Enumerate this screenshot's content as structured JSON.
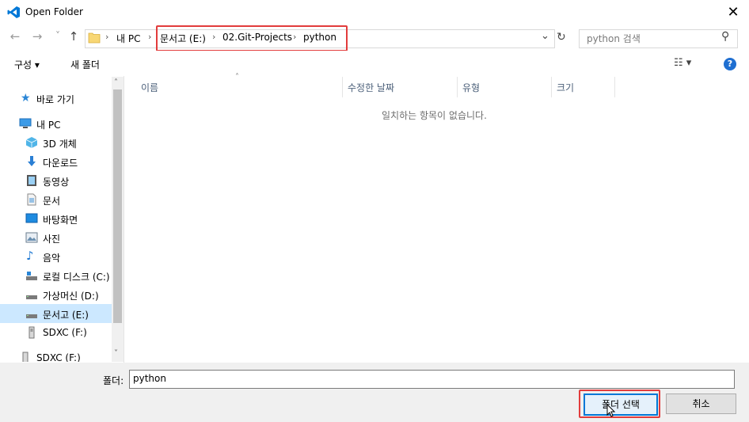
{
  "window": {
    "title": "Open Folder",
    "close_glyph": "✕"
  },
  "nav": {
    "back": "←",
    "forward": "→",
    "recent": "˅",
    "up": "↑"
  },
  "address": {
    "crumbs": [
      "내 PC",
      "문서고 (E:)",
      "02.Git-Projects",
      "python"
    ],
    "separator": "›",
    "dropdown_glyph": "⌄",
    "refresh_glyph": "↻"
  },
  "search": {
    "placeholder": "python 검색",
    "icon_glyph": "⚲"
  },
  "toolbar": {
    "organize": "구성 ▾",
    "new_folder": "새 폴더",
    "view_glyph": "☷ ▾",
    "help_glyph": "?"
  },
  "sidebar": {
    "items": [
      {
        "label": "바로 가기",
        "icon": "star-icon"
      },
      {
        "label": "내 PC",
        "icon": "computer-icon"
      },
      {
        "label": "3D 개체",
        "icon": "cube-icon"
      },
      {
        "label": "다운로드",
        "icon": "download-icon"
      },
      {
        "label": "동영상",
        "icon": "video-icon"
      },
      {
        "label": "문서",
        "icon": "document-icon"
      },
      {
        "label": "바탕화면",
        "icon": "desktop-icon"
      },
      {
        "label": "사진",
        "icon": "picture-icon"
      },
      {
        "label": "음악",
        "icon": "music-icon"
      },
      {
        "label": "로컬 디스크 (C:)",
        "icon": "drive-icon"
      },
      {
        "label": "가상머신 (D:)",
        "icon": "drive-icon"
      },
      {
        "label": "문서고 (E:)",
        "icon": "drive-icon"
      },
      {
        "label": "SDXC (F:)",
        "icon": "sd-card-icon"
      },
      {
        "label": "SDXC (F:)",
        "icon": "sd-card-icon"
      }
    ],
    "scroll_up": "˄",
    "scroll_down": "˅"
  },
  "file_list": {
    "columns": [
      "이름",
      "수정한 날짜",
      "유형",
      "크기"
    ],
    "sort_glyph": "˄",
    "empty_message": "일치하는 항목이 없습니다."
  },
  "footer": {
    "folder_label": "폴더:",
    "folder_value": "python",
    "select_button": "폴더 선택",
    "cancel_button": "취소"
  },
  "colors": {
    "accent": "#0078d7",
    "highlight": "#e23c3c",
    "selected_bg": "#cce8ff"
  }
}
